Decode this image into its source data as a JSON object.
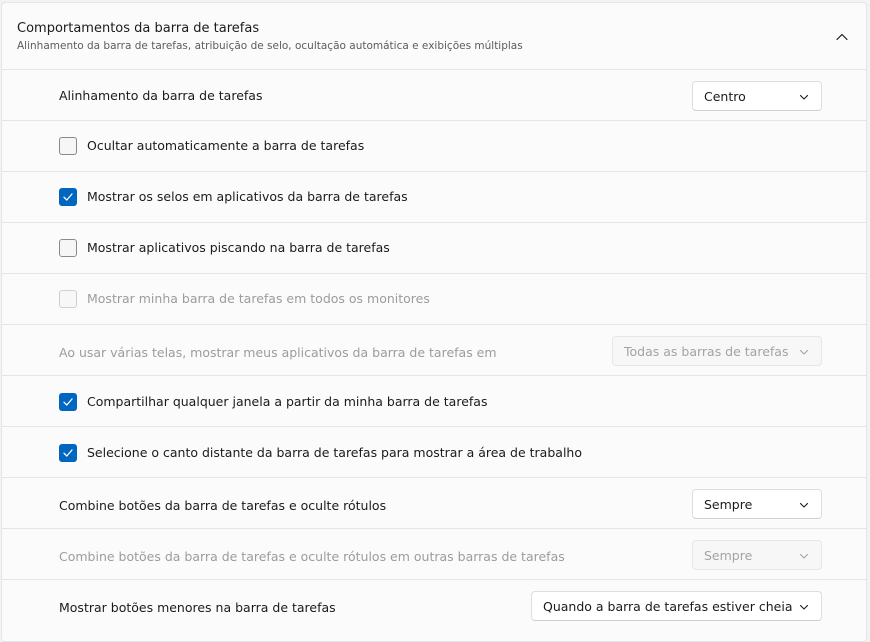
{
  "section": {
    "title": "Comportamentos da barra de tarefas",
    "subtitle": "Alinhamento da barra de tarefas, atribuição de selo, ocultação automática e exibições múltiplas",
    "expanded": true
  },
  "settings": {
    "alignment": {
      "label": "Alinhamento da barra de tarefas",
      "value": "Centro"
    },
    "auto_hide": {
      "label": "Ocultar automaticamente a barra de tarefas",
      "checked": false
    },
    "badges": {
      "label": "Mostrar os selos em aplicativos da barra de tarefas",
      "checked": true
    },
    "flashing": {
      "label": "Mostrar aplicativos piscando na barra de tarefas",
      "checked": false
    },
    "all_monitors": {
      "label": "Mostrar minha barra de tarefas em todos os monitores",
      "checked": false,
      "disabled": true
    },
    "multi_display": {
      "label": "Ao usar várias telas, mostrar meus aplicativos da barra de tarefas em",
      "value": "Todas as barras de tarefas",
      "disabled": true
    },
    "share_window": {
      "label": "Compartilhar qualquer janela a partir da minha barra de tarefas",
      "checked": true
    },
    "far_corner": {
      "label": "Selecione o canto distante da barra de tarefas para mostrar a área de trabalho",
      "checked": true
    },
    "combine_buttons": {
      "label": "Combine botões da barra de tarefas e oculte rótulos",
      "value": "Sempre"
    },
    "combine_other": {
      "label": "Combine botões da barra de tarefas e oculte rótulos em outras barras de tarefas",
      "value": "Sempre",
      "disabled": true
    },
    "smaller_buttons": {
      "label": "Mostrar botões menores na barra de tarefas",
      "value": "Quando a barra de tarefas estiver cheia"
    }
  },
  "colors": {
    "accent": "#0067c0",
    "background": "#fbfbfb",
    "disabled_text": "#9c9c9c"
  },
  "icons": {
    "collapse": "chevron-up-icon",
    "dropdown": "chevron-down-icon",
    "check": "checkmark-icon"
  }
}
